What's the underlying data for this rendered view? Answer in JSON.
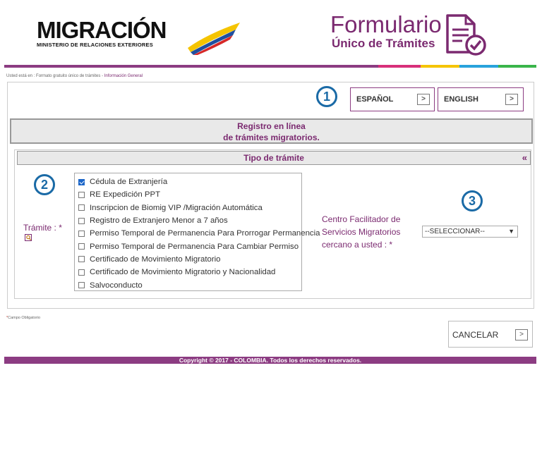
{
  "header": {
    "logo_title": "MIGRACIÓN",
    "logo_subtitle": "MINISTERIO DE RELACIONES EXTERIORES",
    "form_title_line1": "Formulario",
    "form_title_line2": "Único de Trámites"
  },
  "colors": {
    "brand": "#7b2a70",
    "bar": [
      "#8c3c82",
      "#8c3c82",
      "#d8307a",
      "#f5c400",
      "#29a3dc",
      "#3ab54a"
    ]
  },
  "breadcrumb": {
    "prefix": "Usted está en : Formato gratuito único de trámites - ",
    "current": "Información General"
  },
  "language": {
    "spanish_label": "ESPAÑOL",
    "english_label": "ENGLISH",
    "arrow": ">"
  },
  "markers": {
    "one": "1",
    "two": "2",
    "three": "3"
  },
  "registro": {
    "line1": "Registro en línea",
    "line2": "de trámites migratorios."
  },
  "tipo": {
    "title": "Tipo de trámite",
    "collapse": "«"
  },
  "tramite": {
    "label": "Trámite : *",
    "options": [
      {
        "label": "Cédula de Extranjería",
        "checked": true
      },
      {
        "label": "RE Expedición PPT",
        "checked": false
      },
      {
        "label": "Inscripcion de Biomig VIP /Migración Automática",
        "checked": false
      },
      {
        "label": "Registro de Extranjero Menor a 7 años",
        "checked": false
      },
      {
        "label": "Permiso Temporal de Permanencia Para Prorrogar Permanencia",
        "checked": false
      },
      {
        "label": "Permiso Temporal de Permanencia Para Cambiar Permiso",
        "checked": false
      },
      {
        "label": "Certificado de Movimiento Migratorio",
        "checked": false
      },
      {
        "label": "Certificado de Movimiento Migratorio y Nacionalidad",
        "checked": false
      },
      {
        "label": "Salvoconducto",
        "checked": false
      }
    ]
  },
  "centro": {
    "label": "Centro Facilitador de Servicios Migratorios cercano a usted : *",
    "select_value": "--SELECCIONAR--"
  },
  "required_note": {
    "asterisk": "*",
    "text": "Campo Obligatorio"
  },
  "cancel": {
    "label": "CANCELAR",
    "arrow": ">"
  },
  "footer": {
    "text": "Copyright © 2017 - COLOMBIA. Todos los derechos reservados."
  }
}
